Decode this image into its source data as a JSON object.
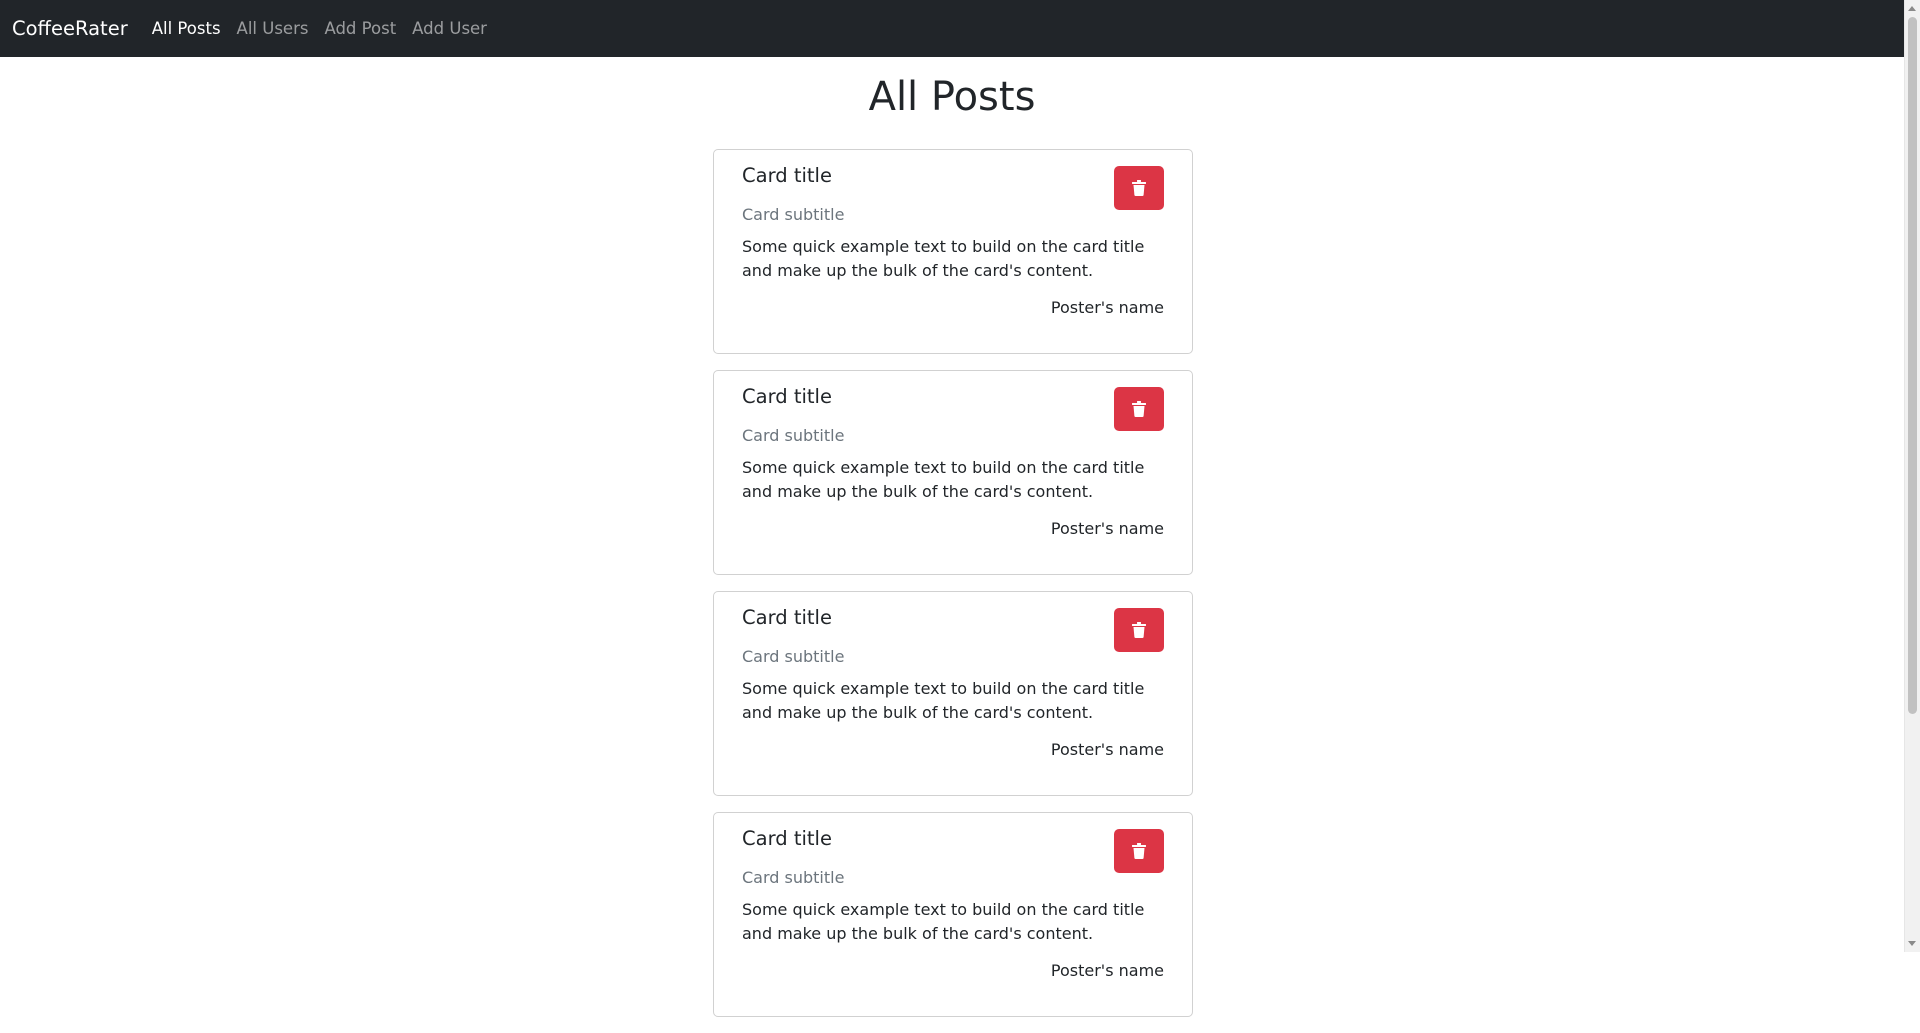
{
  "navbar": {
    "brand": "CoffeeRater",
    "links": [
      {
        "label": "All Posts",
        "active": true
      },
      {
        "label": "All Users",
        "active": false
      },
      {
        "label": "Add Post",
        "active": false
      },
      {
        "label": "Add User",
        "active": false
      }
    ]
  },
  "page": {
    "title": "All Posts"
  },
  "posts": [
    {
      "title": "Card title",
      "subtitle": "Card subtitle",
      "text": "Some quick example text to build on the card title and make up the bulk of the card's content.",
      "poster": "Poster's name",
      "delete_icon": "trash-icon"
    },
    {
      "title": "Card title",
      "subtitle": "Card subtitle",
      "text": "Some quick example text to build on the card title and make up the bulk of the card's content.",
      "poster": "Poster's name",
      "delete_icon": "trash-icon"
    },
    {
      "title": "Card title",
      "subtitle": "Card subtitle",
      "text": "Some quick example text to build on the card title and make up the bulk of the card's content.",
      "poster": "Poster's name",
      "delete_icon": "trash-icon"
    },
    {
      "title": "Card title",
      "subtitle": "Card subtitle",
      "text": "Some quick example text to build on the card title and make up the bulk of the card's content.",
      "poster": "Poster's name",
      "delete_icon": "trash-icon"
    }
  ],
  "colors": {
    "navbar_bg": "#212529",
    "danger": "#dc3545",
    "muted": "#6c757d",
    "text": "#212529"
  }
}
